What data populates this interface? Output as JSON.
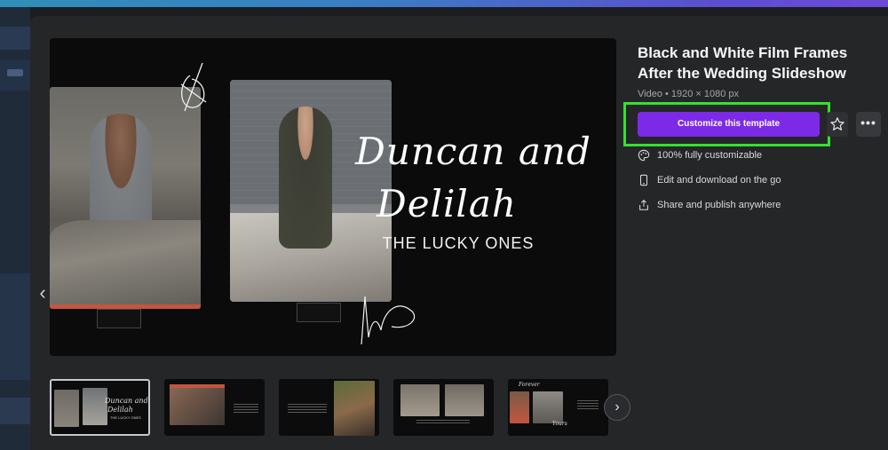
{
  "template": {
    "title": "Black and White Film Frames After the Wedding Slideshow",
    "meta": "Video • 1920 × 1080 px",
    "cta_label": "Customize this template",
    "more_label": "•••"
  },
  "preview": {
    "script_line1": "Duncan and",
    "script_line2": "Delilah",
    "tagline": "THE LUCKY ONES"
  },
  "features": [
    {
      "icon": "palette-icon",
      "label": "100% fully customizable"
    },
    {
      "icon": "phone-icon",
      "label": "Edit and download on the go"
    },
    {
      "icon": "share-icon",
      "label": "Share and publish anywhere"
    }
  ],
  "thumbnails": {
    "thumb1_line1": "Duncan and",
    "thumb1_line2": "Delilah",
    "thumb1_caption": "THE LUCKY ONES",
    "thumb5_script": "Forever",
    "thumb5_script2": "Yours"
  },
  "nav": {
    "back_glyph": "‹",
    "next_glyph": "›"
  },
  "colors": {
    "accent": "#7d2ae8",
    "highlight": "#35e12f"
  }
}
